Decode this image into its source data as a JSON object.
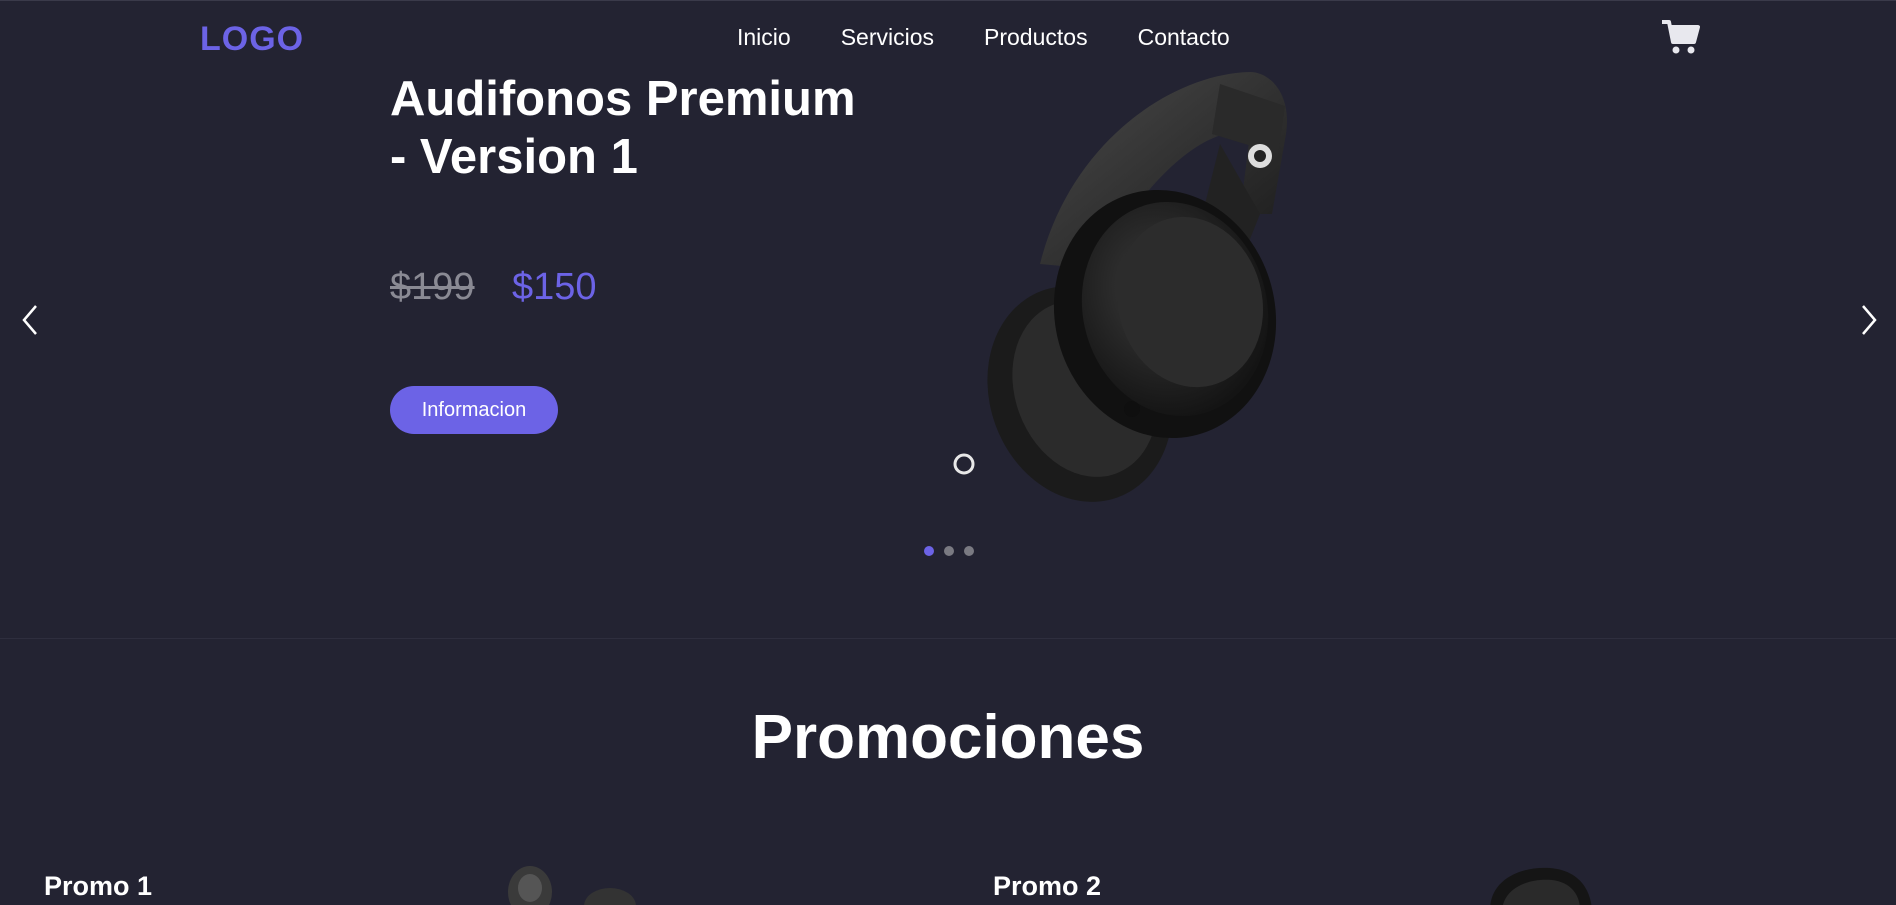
{
  "header": {
    "logo": "LOGO",
    "nav": [
      "Inicio",
      "Servicios",
      "Productos",
      "Contacto"
    ],
    "cart_icon": "shopping-cart-icon"
  },
  "hero": {
    "title": "Audifonos Premium - Version 1",
    "old_price": "$199",
    "new_price": "$150",
    "button_label": "Informacion",
    "prev_icon": "chevron-left-icon",
    "next_icon": "chevron-right-icon",
    "slides_total": 3,
    "active_slide": 1
  },
  "promotions": {
    "title": "Promociones",
    "items": [
      {
        "title": "Promo 1"
      },
      {
        "title": "Promo 2"
      }
    ]
  },
  "colors": {
    "background": "#232332",
    "accent": "#6c63e6",
    "text": "#ffffff",
    "muted": "#8a8a94"
  }
}
